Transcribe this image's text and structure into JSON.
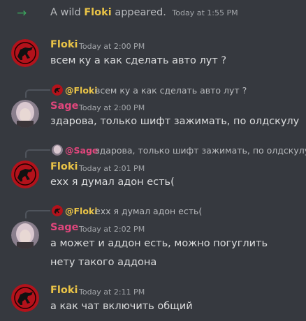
{
  "system": {
    "prefix": "A wild",
    "name": "Floki",
    "suffix": "appeared.",
    "time": "Today at 1:55 PM",
    "icon": "join-arrow-icon"
  },
  "messages": [
    {
      "author": "Floki",
      "time": "Today at 2:00 PM",
      "lines": [
        "всем ку а как сделать авто лут ?"
      ]
    },
    {
      "reply": {
        "mention": "@Floki",
        "text": "всем ку а как сделать авто лут ?"
      },
      "author": "Sage",
      "time": "Today at 2:00 PM",
      "lines": [
        "здарова, только шифт зажимать, по олдскулу"
      ]
    },
    {
      "reply": {
        "mention": "@Sage",
        "text": "здарова, только шифт зажимать, по олдскулу"
      },
      "author": "Floki",
      "time": "Today at 2:01 PM",
      "lines": [
        "ехх я думал адон есть("
      ]
    },
    {
      "reply": {
        "mention": "@Floki",
        "text": "ехх я думал адон есть("
      },
      "author": "Sage",
      "time": "Today at 2:02 PM",
      "lines": [
        "а может и аддон есть, можно погуглить",
        "нету такого аддона"
      ]
    },
    {
      "author": "Floki",
      "time": "Today at 2:11 PM",
      "lines": [
        "а как чат включить общий"
      ]
    }
  ],
  "colors": {
    "background": "#36393f",
    "floki": "#e9c347",
    "sage": "#e0467c",
    "join_arrow": "#3ba55d"
  }
}
